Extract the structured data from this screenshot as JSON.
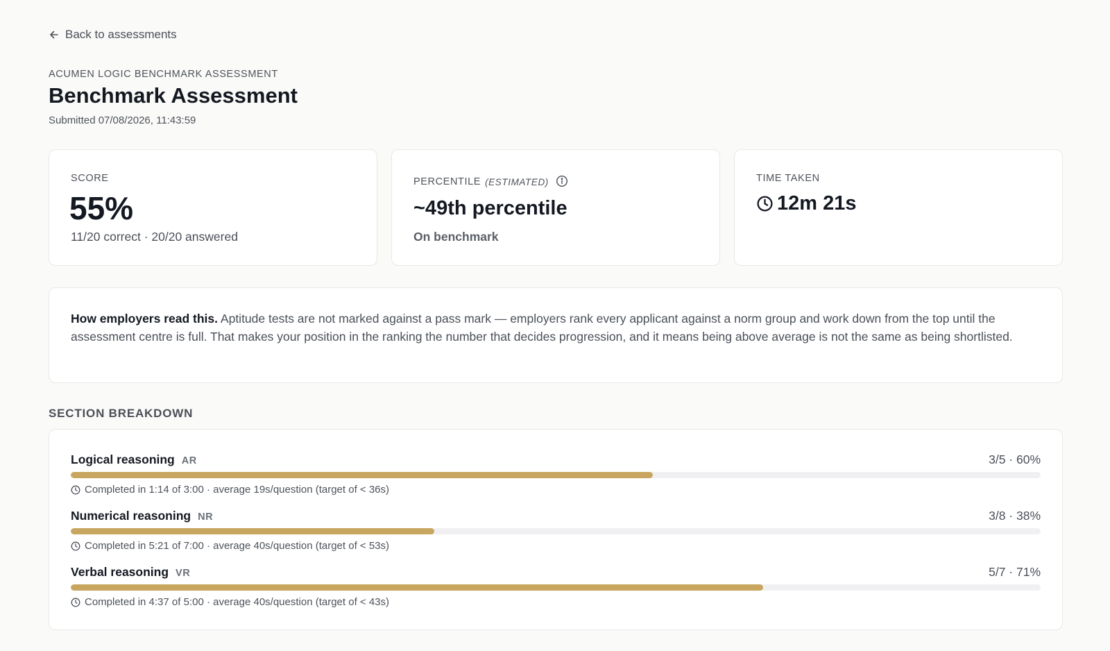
{
  "nav": {
    "back_label": "Back to assessments"
  },
  "header": {
    "kicker": "ACUMEN LOGIC BENCHMARK ASSESSMENT",
    "title": "Benchmark Assessment",
    "submitted": "Submitted 07/08/2026, 11:43:59"
  },
  "stats": {
    "score": {
      "label": "SCORE",
      "value": "55%",
      "sub": "11/20 correct · 20/20 answered"
    },
    "percentile": {
      "label": "PERCENTILE",
      "label_suffix": "(ESTIMATED)",
      "value": "~49th percentile",
      "sub": "On benchmark"
    },
    "time": {
      "label": "TIME TAKEN",
      "value": "12m 21s"
    }
  },
  "info": {
    "lead": "How employers read this.",
    "body": " Aptitude tests are not marked against a pass mark — employers rank every applicant against a norm group and work down from the top until the assessment centre is full. That makes your position in the ranking the number that decides progression, and it means being above average is not the same as being shortlisted."
  },
  "breakdown": {
    "heading": "SECTION BREAKDOWN",
    "sections": [
      {
        "name": "Logical reasoning",
        "code": "AR",
        "score": "3/5 · 60%",
        "fraction": 0.6,
        "meta": "Completed in 1:14 of 3:00 · average 19s/question (target of < 36s)"
      },
      {
        "name": "Numerical reasoning",
        "code": "NR",
        "score": "3/8 · 38%",
        "fraction": 0.375,
        "meta": "Completed in 5:21 of 7:00 · average 40s/question (target of < 53s)"
      },
      {
        "name": "Verbal reasoning",
        "code": "VR",
        "score": "5/7 · 71%",
        "fraction": 0.714,
        "meta": "Completed in 4:37 of 5:00 · average 40s/question (target of < 43s)"
      }
    ]
  },
  "colors": {
    "bar_fill": "#c9a65f",
    "bar_track": "#f0f0f3",
    "background": "#fafaf8"
  }
}
